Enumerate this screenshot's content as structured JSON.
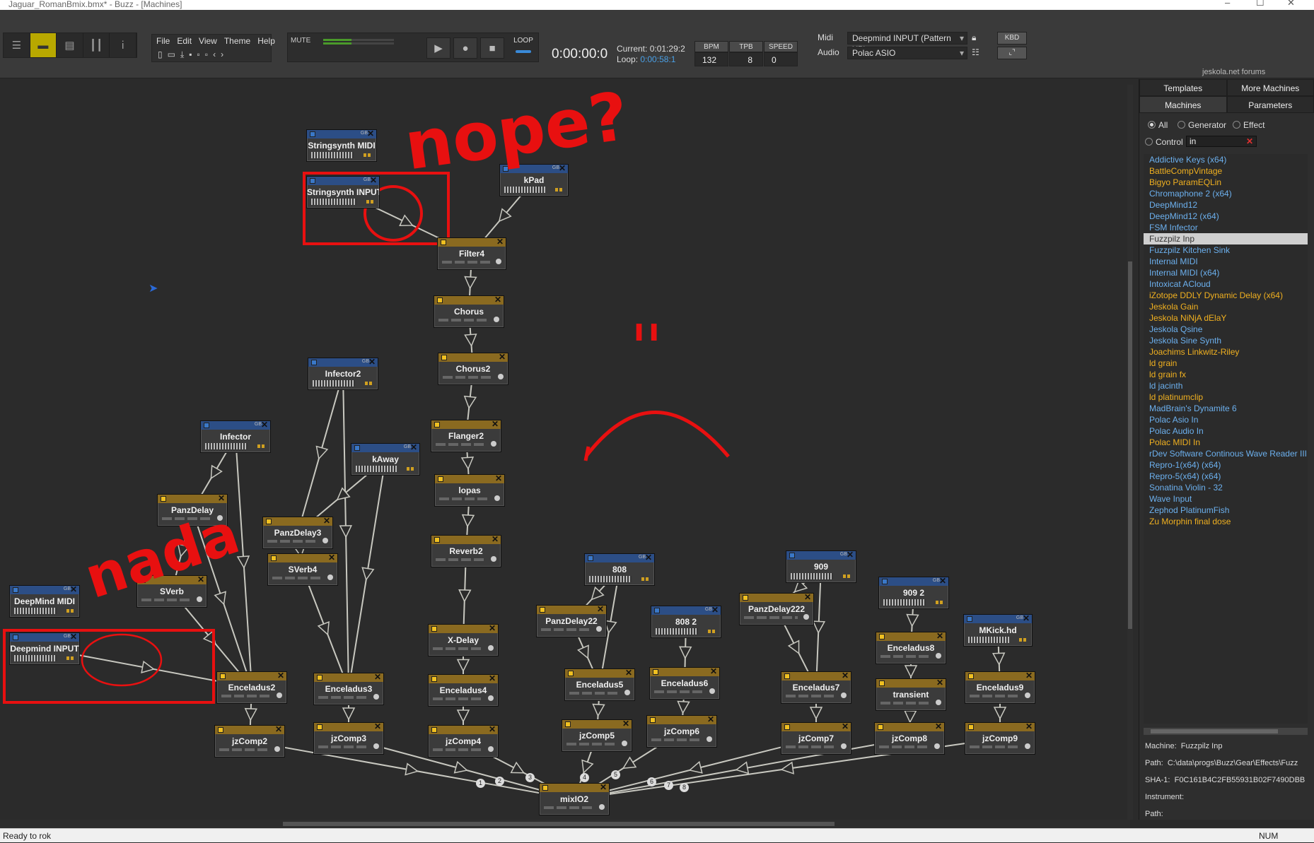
{
  "window": {
    "title": "Jaguar_RomanBmix.bmx* - Buzz - [Machines]"
  },
  "menu": [
    "File",
    "Edit",
    "View",
    "Theme",
    "Help"
  ],
  "transport": {
    "mute": "MUTE",
    "loop": "LOOP",
    "time": "0:00:00:0",
    "current_label": "Current:",
    "current": "0:01:29:2",
    "loop_label": "Loop:",
    "loop_time": "0:00:58:1"
  },
  "tempo": {
    "bpm_label": "BPM",
    "bpm": "132",
    "tpb_label": "TPB",
    "tpb": "8",
    "speed_label": "SPEED",
    "speed": "0"
  },
  "devices": {
    "midi_label": "Midi",
    "midi": "Deepmind INPUT (Pattern XP)",
    "audio_label": "Audio",
    "audio": "Polac ASIO",
    "kbd": "KBD"
  },
  "forums": "jeskola.net forums",
  "machines": [
    {
      "name": "Stringsynth MIDI",
      "kind": "gen"
    },
    {
      "name": "Stringsynth INPUT",
      "kind": "gen"
    },
    {
      "name": "kPad",
      "kind": "gen"
    },
    {
      "name": "Filter4",
      "kind": "eff"
    },
    {
      "name": "Chorus",
      "kind": "eff"
    },
    {
      "name": "Chorus2",
      "kind": "eff"
    },
    {
      "name": "Flanger2",
      "kind": "eff"
    },
    {
      "name": "lopas",
      "kind": "eff"
    },
    {
      "name": "Reverb2",
      "kind": "eff"
    },
    {
      "name": "X-Delay",
      "kind": "eff"
    },
    {
      "name": "Enceladus4",
      "kind": "eff"
    },
    {
      "name": "jzComp4",
      "kind": "eff"
    },
    {
      "name": "Infector2",
      "kind": "gen"
    },
    {
      "name": "Infector",
      "kind": "gen"
    },
    {
      "name": "kAway",
      "kind": "gen"
    },
    {
      "name": "PanzDelay",
      "kind": "eff"
    },
    {
      "name": "PanzDelay3",
      "kind": "eff"
    },
    {
      "name": "SVerb4",
      "kind": "eff"
    },
    {
      "name": "SVerb",
      "kind": "eff"
    },
    {
      "name": "DeepMind MIDI",
      "kind": "gen"
    },
    {
      "name": "Deepmind INPUT",
      "kind": "gen"
    },
    {
      "name": "Enceladus2",
      "kind": "eff"
    },
    {
      "name": "Enceladus3",
      "kind": "eff"
    },
    {
      "name": "jzComp2",
      "kind": "eff"
    },
    {
      "name": "jzComp3",
      "kind": "eff"
    },
    {
      "name": "808",
      "kind": "gen"
    },
    {
      "name": "PanzDelay22",
      "kind": "eff"
    },
    {
      "name": "Enceladus5",
      "kind": "eff"
    },
    {
      "name": "jzComp5",
      "kind": "eff"
    },
    {
      "name": "808 2",
      "kind": "gen"
    },
    {
      "name": "Enceladus6",
      "kind": "eff"
    },
    {
      "name": "jzComp6",
      "kind": "eff"
    },
    {
      "name": "909",
      "kind": "gen"
    },
    {
      "name": "PanzDelay222",
      "kind": "eff"
    },
    {
      "name": "Enceladus7",
      "kind": "eff"
    },
    {
      "name": "jzComp7",
      "kind": "eff"
    },
    {
      "name": "909 2",
      "kind": "gen"
    },
    {
      "name": "Enceladus8",
      "kind": "eff"
    },
    {
      "name": "transient",
      "kind": "eff"
    },
    {
      "name": "jzComp8",
      "kind": "eff"
    },
    {
      "name": "MKick.hd",
      "kind": "gen"
    },
    {
      "name": "Enceladus9",
      "kind": "eff"
    },
    {
      "name": "jzComp9",
      "kind": "eff"
    },
    {
      "name": "mixIO2",
      "kind": "mst"
    }
  ],
  "mix_inputs": [
    "1",
    "2",
    "3",
    "4",
    "5",
    "6",
    "7",
    "8"
  ],
  "annotations": {
    "nope": "nope?",
    "nada": "nada"
  },
  "panel": {
    "tabs_top": [
      "Templates",
      "More Machines"
    ],
    "tabs_bottom": [
      "Machines",
      "Parameters"
    ],
    "filters": [
      "All",
      "Generator",
      "Effect",
      "Control"
    ],
    "filter_text": "in",
    "list": [
      {
        "name": "Addictive Keys (x64)",
        "kind": "gen"
      },
      {
        "name": "BattleCompVintage",
        "kind": "eff"
      },
      {
        "name": "Bigyo ParamEQLin",
        "kind": "eff"
      },
      {
        "name": "Chromaphone 2 (x64)",
        "kind": "gen"
      },
      {
        "name": "DeepMind12",
        "kind": "gen"
      },
      {
        "name": "DeepMind12 (x64)",
        "kind": "gen"
      },
      {
        "name": "FSM Infector",
        "kind": "gen"
      },
      {
        "name": "Fuzzpilz Inp",
        "kind": "sel"
      },
      {
        "name": "Fuzzpilz Kitchen Sink",
        "kind": "gen"
      },
      {
        "name": "Internal MIDI",
        "kind": "gen"
      },
      {
        "name": "Internal MIDI (x64)",
        "kind": "gen"
      },
      {
        "name": "Intoxicat ACloud",
        "kind": "gen"
      },
      {
        "name": "iZotope DDLY Dynamic Delay (x64)",
        "kind": "eff"
      },
      {
        "name": "Jeskola Gain",
        "kind": "eff"
      },
      {
        "name": "Jeskola NiNjA dElaY",
        "kind": "eff"
      },
      {
        "name": "Jeskola Qsine",
        "kind": "gen"
      },
      {
        "name": "Jeskola Sine Synth",
        "kind": "gen"
      },
      {
        "name": "Joachims Linkwitz-Riley",
        "kind": "eff"
      },
      {
        "name": "ld grain",
        "kind": "eff"
      },
      {
        "name": "ld grain fx",
        "kind": "eff"
      },
      {
        "name": "ld jacinth",
        "kind": "gen"
      },
      {
        "name": "ld platinumclip",
        "kind": "eff"
      },
      {
        "name": "MadBrain's Dynamite 6",
        "kind": "gen"
      },
      {
        "name": "Polac Asio In",
        "kind": "gen"
      },
      {
        "name": "Polac Audio In",
        "kind": "gen"
      },
      {
        "name": "Polac MIDI In",
        "kind": "eff"
      },
      {
        "name": "rDev Software Continous Wave Reader III",
        "kind": "gen"
      },
      {
        "name": "Repro-1(x64) (x64)",
        "kind": "gen"
      },
      {
        "name": "Repro-5(x64) (x64)",
        "kind": "gen"
      },
      {
        "name": "Sonatina Violin - 32",
        "kind": "gen"
      },
      {
        "name": "Wave Input",
        "kind": "gen"
      },
      {
        "name": "Zephod PlatinumFish",
        "kind": "gen"
      },
      {
        "name": "Zu Morphin final dose",
        "kind": "eff"
      }
    ],
    "info": {
      "machine_label": "Machine:",
      "machine": "Fuzzpilz Inp",
      "path_label": "Path:",
      "path": "C:\\data\\progs\\Buzz\\Gear\\Effects\\Fuzz",
      "sha_label": "SHA-1:",
      "sha": "F0C161B4C2FB55931B02F7490DBB",
      "instrument_label": "Instrument:",
      "path2_label": "Path:"
    }
  },
  "status": {
    "text": "Ready to rok",
    "num": "NUM"
  },
  "colors": {
    "generator": "#2c4e86",
    "effect": "#8a6a20",
    "annotation": "#e81010",
    "list_generator": "#6cb0ee",
    "list_effect": "#f0b020"
  }
}
